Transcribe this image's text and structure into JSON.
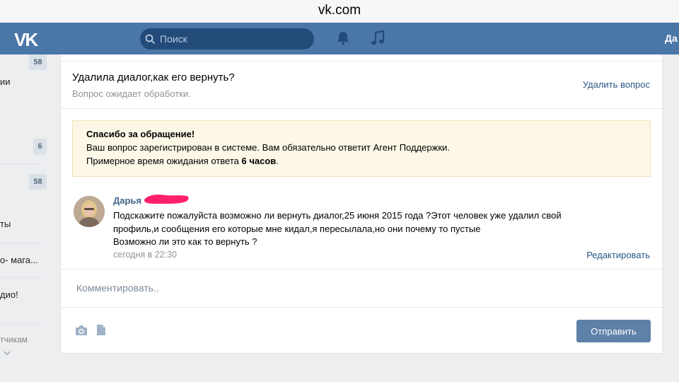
{
  "browser": {
    "url": "vk.com"
  },
  "header": {
    "logo": "VK",
    "search_placeholder": "Поиск",
    "user_name": "Да"
  },
  "sidebar": {
    "badges": [
      "58",
      "6",
      "58"
    ],
    "texts": [
      "ии",
      "ты",
      "о- мага...",
      "дио!"
    ],
    "footer_text": "тчикам"
  },
  "question": {
    "title": "Удалила диалог,как его вернуть?",
    "status": "Вопрос ожидает обработки.",
    "delete_label": "Удалить вопрос"
  },
  "notice": {
    "title": "Спасибо за обращение!",
    "line1": "Ваш вопрос зарегистрирован в системе. Вам обязательно ответит Агент Поддержки.",
    "line2_prefix": "Примерное время ожидания ответа ",
    "line2_bold": "6 часов",
    "line2_suffix": "."
  },
  "message": {
    "author": "Дарья",
    "lines": [
      "Подскажите пожалуйста возможно ли вернуть диалог,25 июня 2015 года ?Этот человек уже удалил свой",
      "профиль,и сообщения его которые мне кидал,я пересылала,но они почему то пустые",
      "Возможно ли это как то вернуть ?"
    ],
    "time": "сегодня в 22:30",
    "edit_label": "Редактировать"
  },
  "comment": {
    "placeholder": "Комментировать..",
    "send_label": "Отправить"
  },
  "icons": [
    "search-icon",
    "bell-icon",
    "music-icon",
    "camera-icon",
    "doc-icon",
    "chevron-down-icon"
  ],
  "colors": {
    "header": "#4a76a8",
    "link": "#2a5885",
    "button": "#5e81a8",
    "notice_bg": "#fcf7e7"
  }
}
